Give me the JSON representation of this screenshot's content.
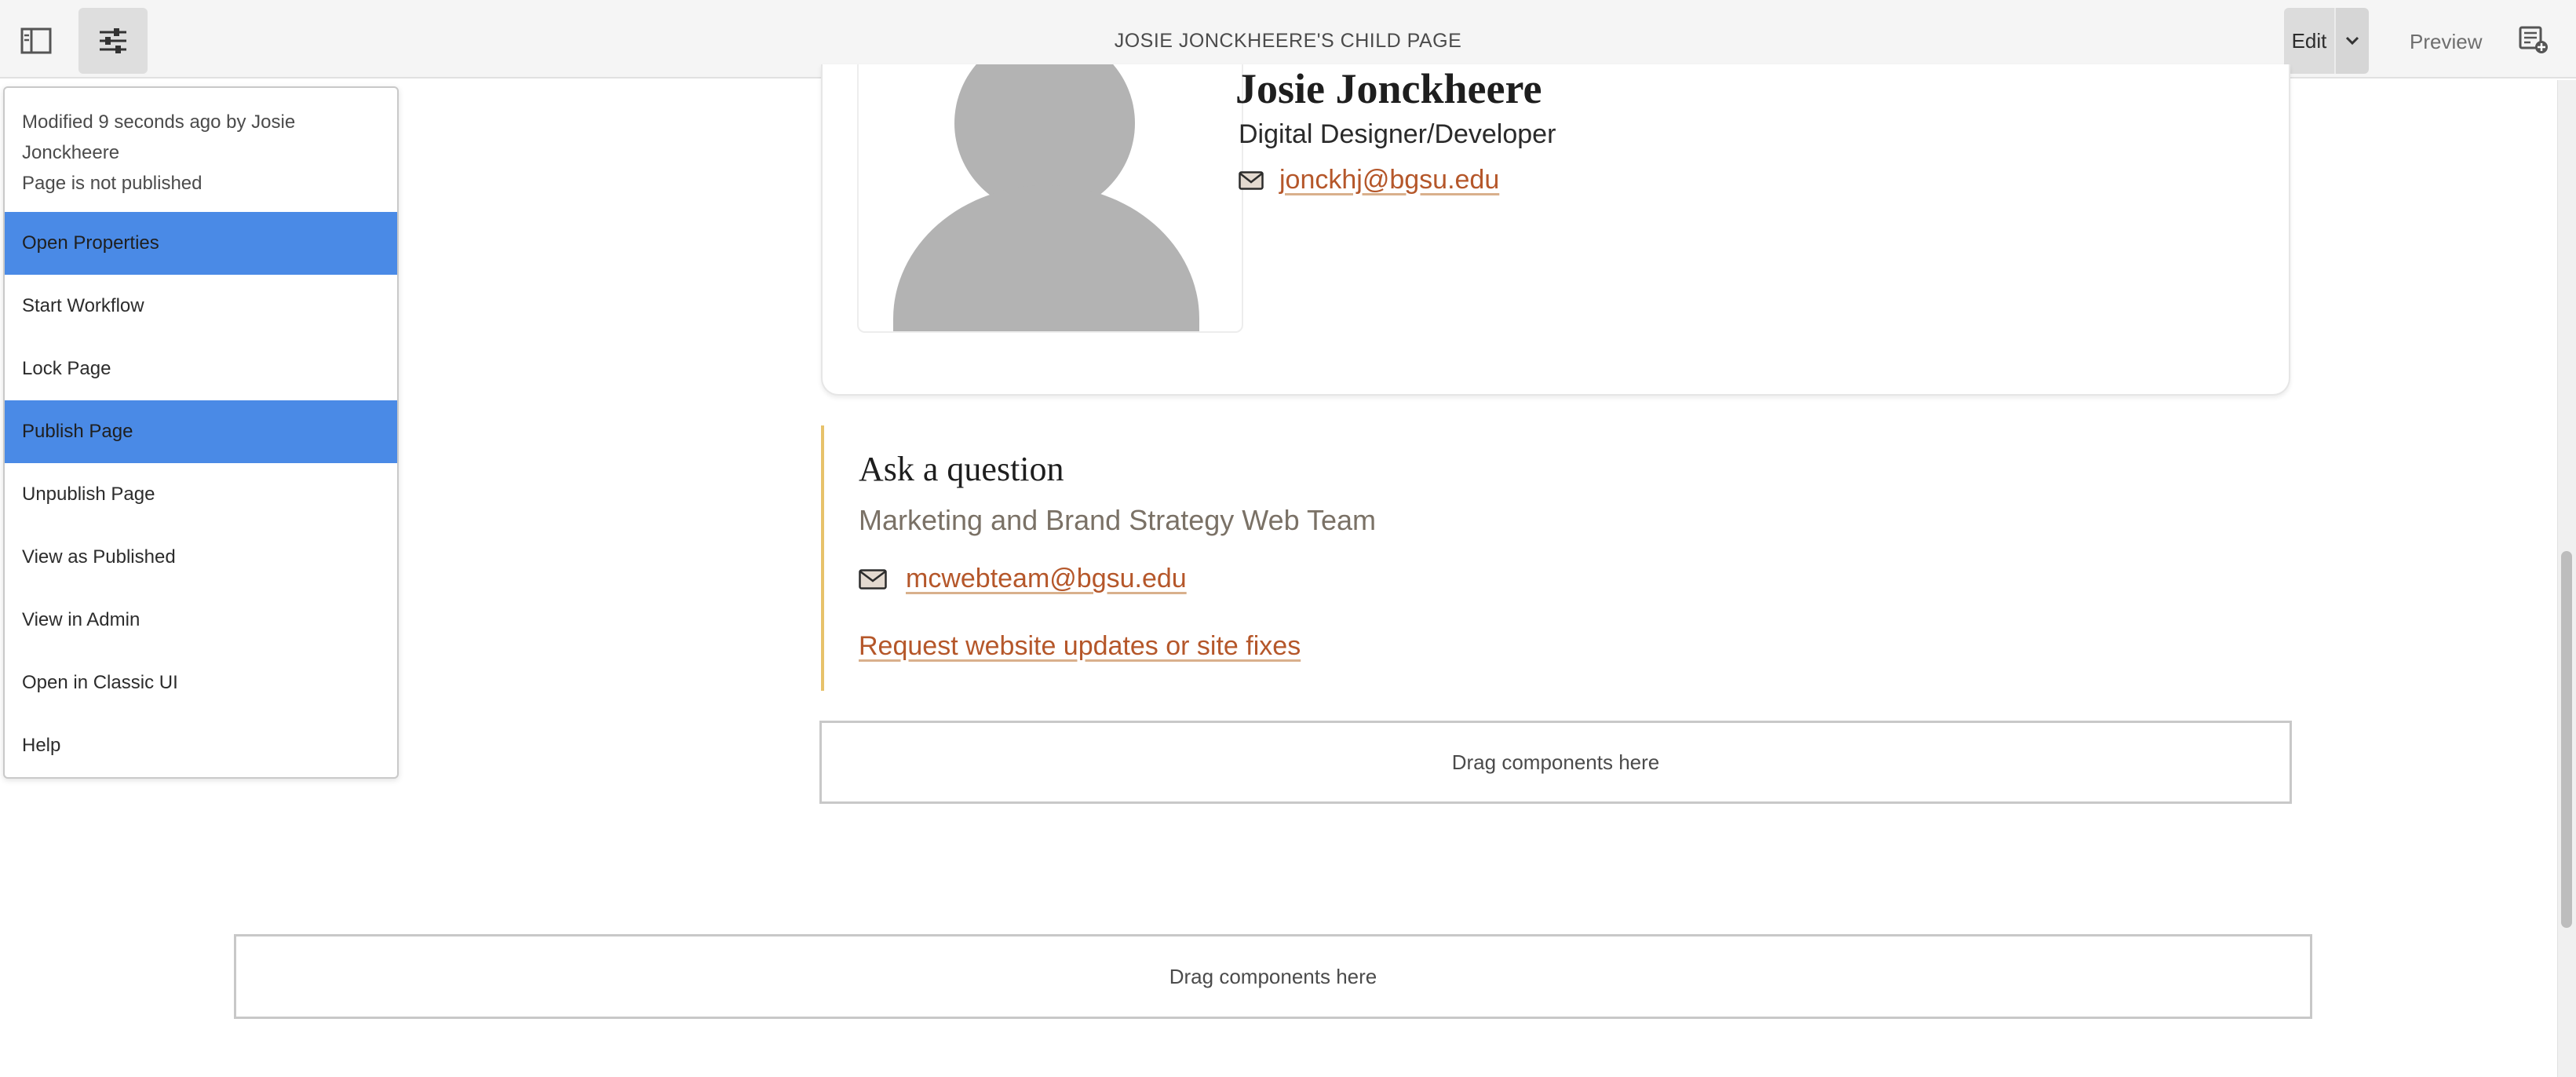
{
  "toolbar": {
    "page_title": "JOSIE JONCKHEERE'S CHILD PAGE",
    "edit_label": "Edit",
    "preview_label": "Preview",
    "icons": {
      "side_panel": "side-panel-icon",
      "page_info": "sliders-icon",
      "mode_dropdown": "chevron-down-icon",
      "annotate": "annotate-icon"
    }
  },
  "page_info_menu": {
    "modified_text": "Modified 9 seconds ago by Josie Jonckheere",
    "publish_status": "Page is not published",
    "items": [
      {
        "label": "Open Properties",
        "highlighted": true
      },
      {
        "label": "Start Workflow",
        "highlighted": false
      },
      {
        "label": "Lock Page",
        "highlighted": false
      },
      {
        "label": "Publish Page",
        "highlighted": true
      },
      {
        "label": "Unpublish Page",
        "highlighted": false
      },
      {
        "label": "View as Published",
        "highlighted": false
      },
      {
        "label": "View in Admin",
        "highlighted": false
      },
      {
        "label": "Open in Classic UI",
        "highlighted": false
      },
      {
        "label": "Help",
        "highlighted": false
      }
    ],
    "highlight_color": "#4a8ae6"
  },
  "profile": {
    "name": "Josie Jonckheere",
    "title": "Digital Designer/Developer",
    "email": "jonckhj@bgsu.edu"
  },
  "ask_question": {
    "heading": "Ask a question",
    "team": "Marketing and Brand Strategy Web Team",
    "email": "mcwebteam@bgsu.edu",
    "request_link": "Request website updates or site fixes"
  },
  "dropzones": {
    "inner": "Drag components here",
    "outer": "Drag components here"
  },
  "colors": {
    "link": "#b5572a",
    "accent_border": "#e7c26b",
    "avatar_gray": "#b3b3b3"
  }
}
